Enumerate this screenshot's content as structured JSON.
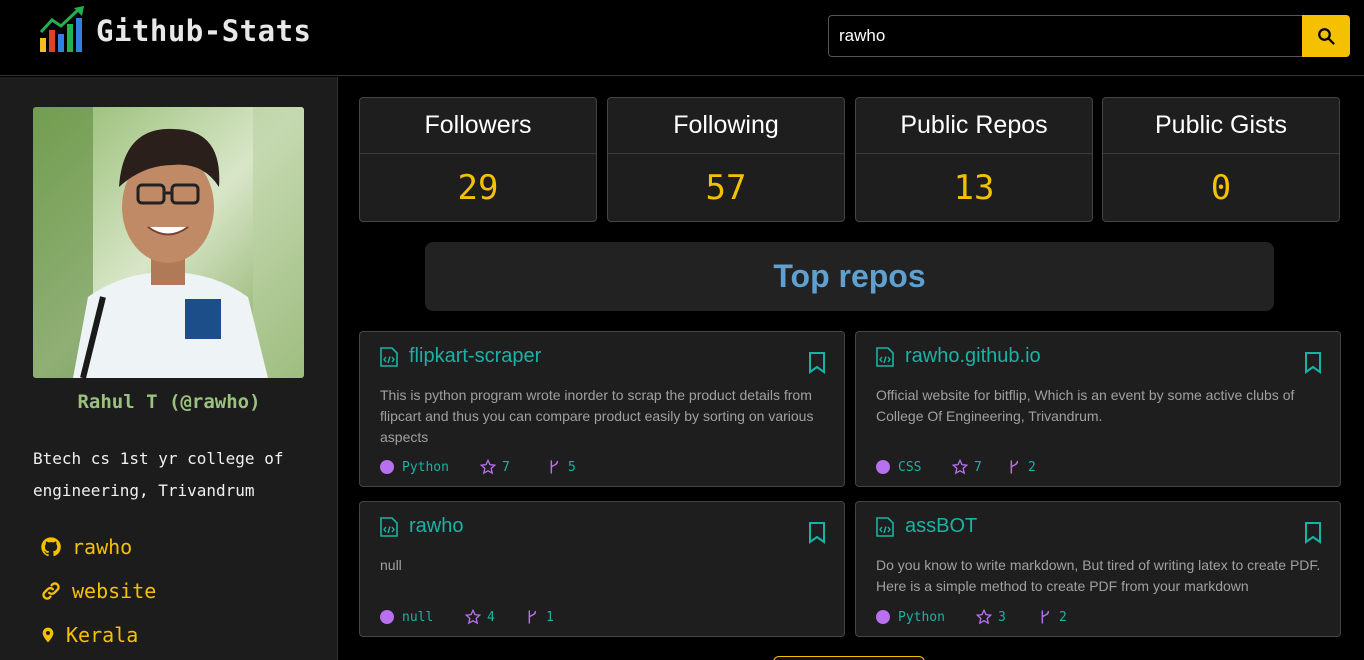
{
  "header": {
    "brand": "Github-Stats",
    "search_value": "rawho",
    "search_icon": "search-icon",
    "accent": "#f5c000"
  },
  "profile": {
    "avatar_icon": "avatar-photo",
    "name": "Rahul T (@rawho)",
    "bio": "Btech cs 1st yr college of engineering, Trivandrum",
    "links": [
      {
        "icon": "github-icon",
        "label": "rawho"
      },
      {
        "icon": "link-icon",
        "label": "website"
      },
      {
        "icon": "location-icon",
        "label": "Kerala"
      }
    ]
  },
  "stats": [
    {
      "label": "Followers",
      "value": "29"
    },
    {
      "label": "Following",
      "value": "57"
    },
    {
      "label": "Public Repos",
      "value": "13"
    },
    {
      "label": "Public Gists",
      "value": "0"
    }
  ],
  "top_repos_title": "Top repos",
  "repos": [
    {
      "name": "flipkart-scraper",
      "description": "This is python program wrote inorder to scrap the product details from flipcart and thus you can compare product easily by sorting on various aspects",
      "language": "Python",
      "stars": "7",
      "forks": "5"
    },
    {
      "name": "rawho.github.io",
      "description": "Official website for bitflip, Which is an event by some active clubs of College Of Engineering, Trivandrum.",
      "language": "CSS",
      "stars": "7",
      "forks": "2"
    },
    {
      "name": "rawho",
      "description": "null",
      "language": "null",
      "stars": "4",
      "forks": "1"
    },
    {
      "name": "assBOT",
      "description": "Do you know to write markdown, But tired of writing latex to create PDF. Here is a simple method to create PDF from your markdown",
      "language": "Python",
      "stars": "3",
      "forks": "2"
    }
  ]
}
